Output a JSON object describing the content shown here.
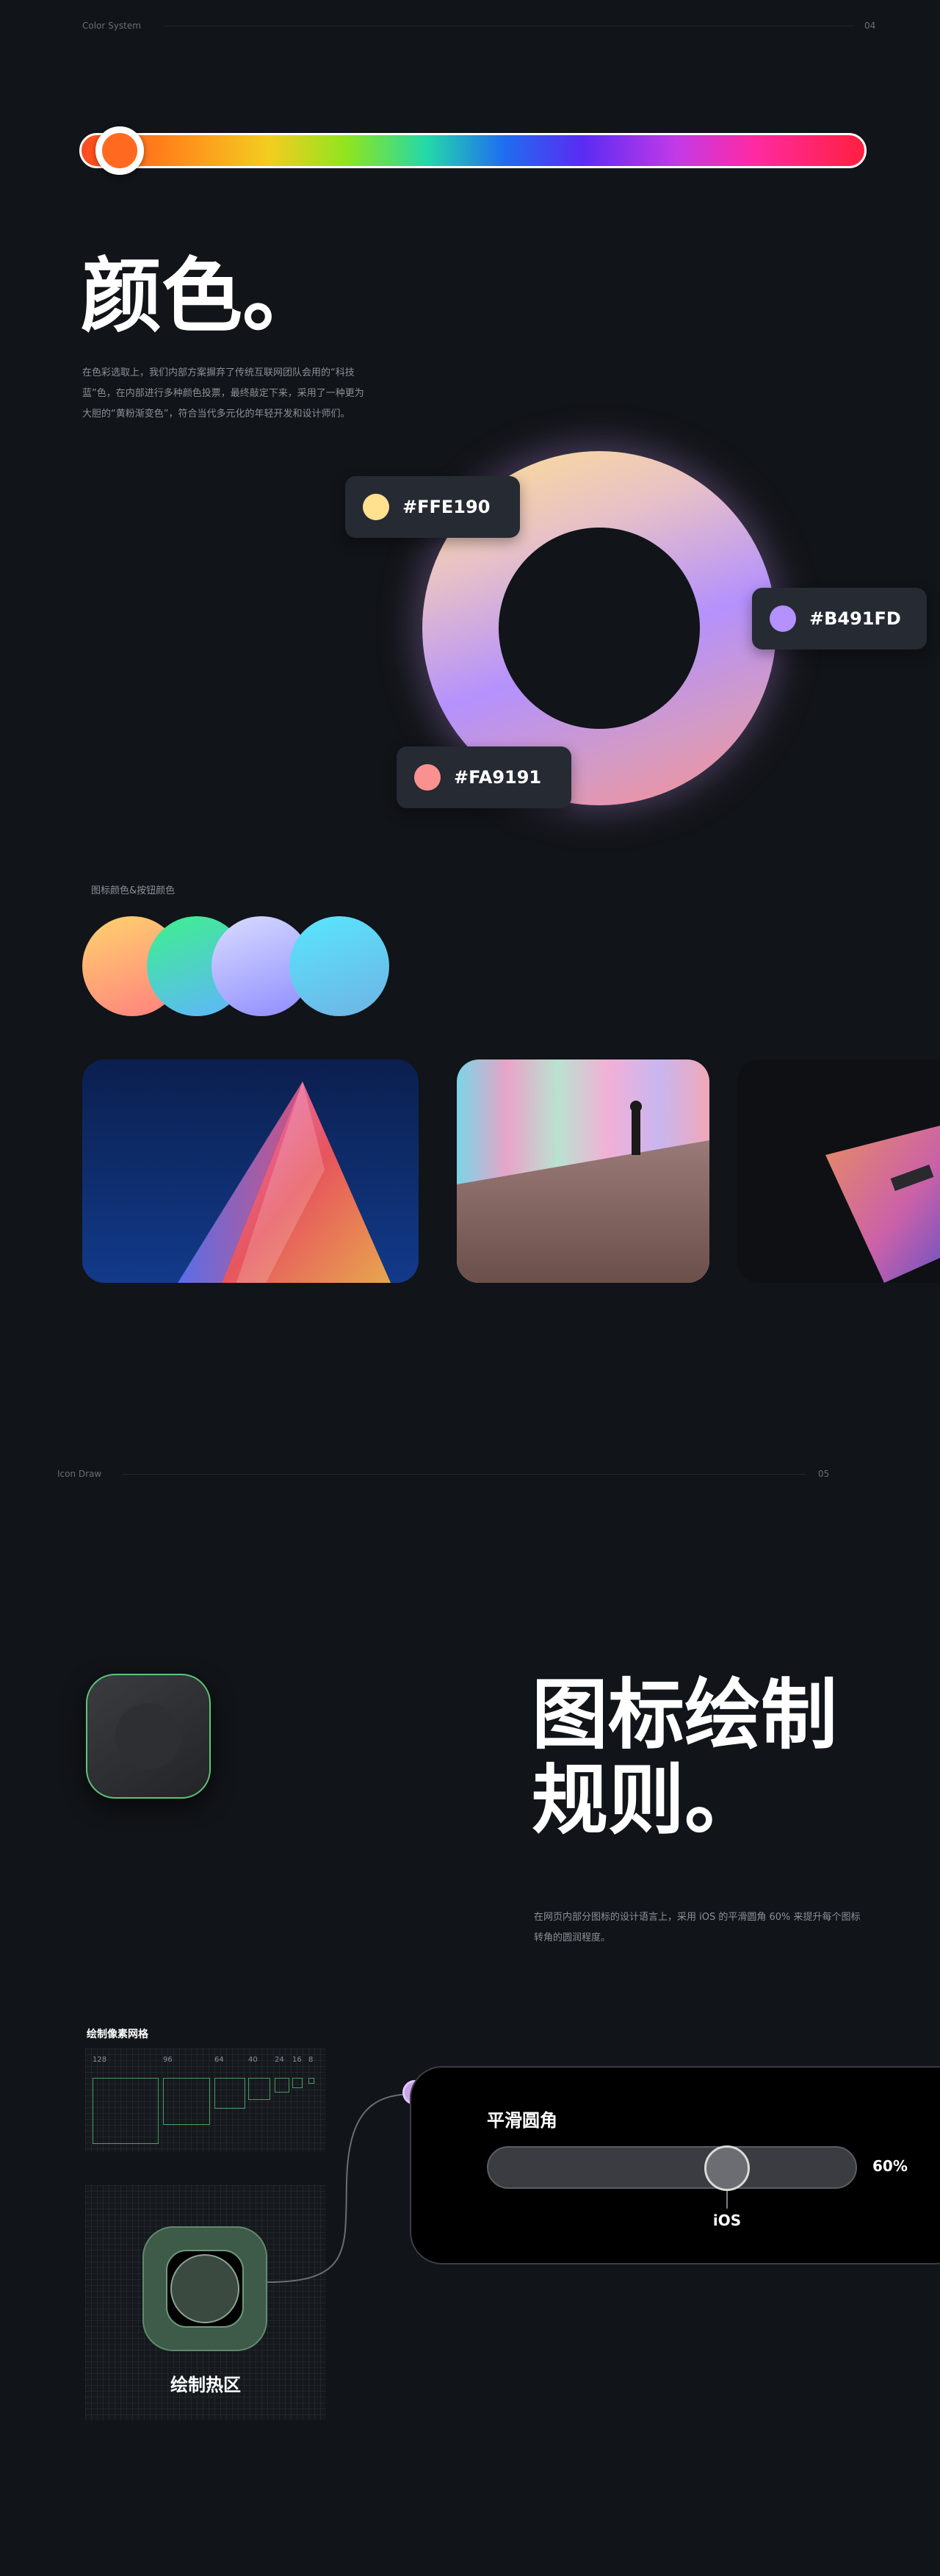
{
  "section1": {
    "label": "Color System",
    "number": "04"
  },
  "colors": {
    "title": "颜色。",
    "description_lines": [
      "在色彩选取上，我们内部方案摒弃了传统互联网团队会用的“科技",
      "蓝”色，在内部进行多种颜色投票，最终敲定下来，采用了一种更为",
      "大胆的“黄粉渐变色”，符合当代多元化的年轻开发和设计师们。"
    ],
    "swatches": [
      {
        "hex": "#FFE190",
        "color": "#FFE190"
      },
      {
        "hex": "#B491FD",
        "color": "#B491FD"
      },
      {
        "hex": "#FA9191",
        "color": "#FA9191"
      }
    ],
    "icon_button_label": "图标颜色&按钮颜色",
    "gradient_circles": [
      {
        "from": "#ffd36e",
        "to": "#ff7f7f"
      },
      {
        "from": "#3ef08c",
        "to": "#5fb4ff"
      },
      {
        "from": "#d8dcff",
        "to": "#8f8cff"
      },
      {
        "from": "#58e6ff",
        "to": "#6fb3e3"
      }
    ],
    "accent_slider": {
      "level": 0.05,
      "track_colors": [
        "#ff4a1f",
        "#f3cd1f",
        "#24d9a8",
        "#1f6df0",
        "#c33ae8",
        "#ff2040"
      ]
    }
  },
  "section2": {
    "label": "Icon Draw",
    "number": "05"
  },
  "icon_draw": {
    "title_line1": "图标绘制",
    "title_line2": "规则。",
    "description_lines": [
      "在网页内部分图标的设计语言上，采用 iOS 的平滑圆角 60% 来提升每个图标",
      "转角的圆润程度。"
    ],
    "grid_title": "绘制像素网格",
    "pixel_sizes": [
      "128",
      "96",
      "64",
      "40",
      "24",
      "16",
      "8"
    ],
    "hotzone_label": "绘制热区",
    "smooth_corner": {
      "title": "平滑圆角",
      "value": "60%",
      "caption": "iOS",
      "level": 0.6
    }
  }
}
